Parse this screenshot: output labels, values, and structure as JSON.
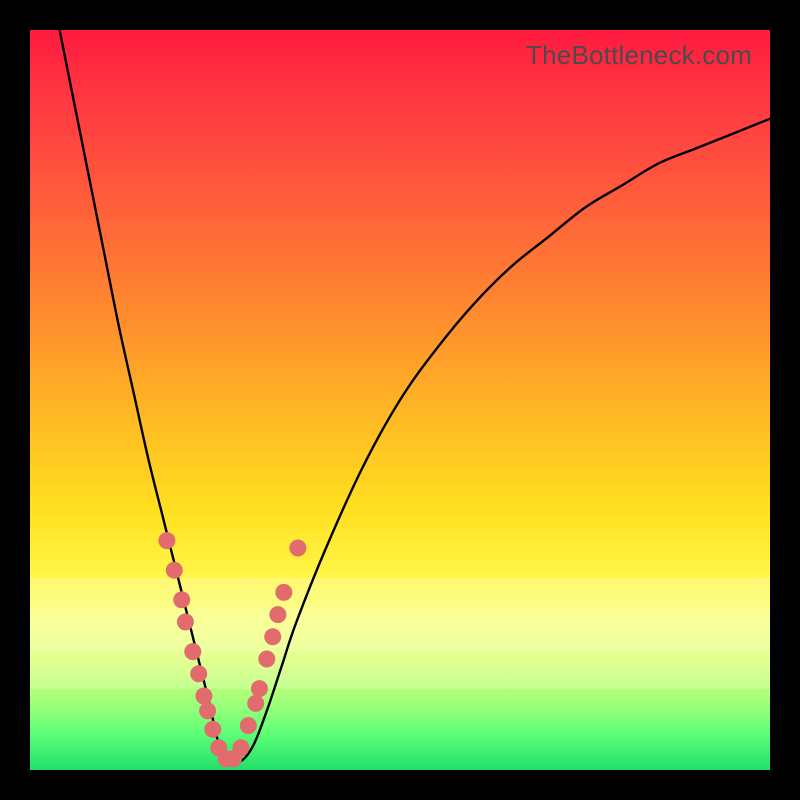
{
  "watermark": "TheBottleneck.com",
  "colors": {
    "curve": "#000000",
    "marker_fill": "#e16b6d",
    "marker_stroke": "#b44a4e",
    "frame": "#000000"
  },
  "chart_data": {
    "type": "line",
    "title": "",
    "xlabel": "",
    "ylabel": "",
    "xlim": [
      0,
      100
    ],
    "ylim": [
      0,
      100
    ],
    "grid": false,
    "legend": false,
    "note": "No axis ticks or numeric labels are rendered in the image; curve shape is a V/valley with minimum near x≈26 and y≈0. Values below are estimated from pixel positions (y = 0 at bottom, 100 at top).",
    "series": [
      {
        "name": "bottleneck-curve",
        "x": [
          4,
          6,
          8,
          10,
          12,
          14,
          16,
          18,
          20,
          22,
          24,
          26,
          28,
          30,
          32,
          34,
          36,
          40,
          45,
          50,
          55,
          60,
          65,
          70,
          75,
          80,
          85,
          90,
          95,
          100
        ],
        "y": [
          100,
          90,
          80,
          70,
          60,
          51,
          42,
          34,
          26,
          18,
          10,
          2,
          1,
          3,
          8,
          14,
          20,
          30,
          41,
          50,
          57,
          63,
          68,
          72,
          76,
          79,
          82,
          84,
          86,
          88
        ]
      }
    ],
    "markers": {
      "name": "highlight-points",
      "note": "Salmon-colored dots clustered near the valley on both branches.",
      "points": [
        {
          "x": 18.5,
          "y": 31
        },
        {
          "x": 19.5,
          "y": 27
        },
        {
          "x": 20.5,
          "y": 23
        },
        {
          "x": 21.0,
          "y": 20
        },
        {
          "x": 22.0,
          "y": 16
        },
        {
          "x": 22.8,
          "y": 13
        },
        {
          "x": 23.5,
          "y": 10
        },
        {
          "x": 24.0,
          "y": 8
        },
        {
          "x": 24.7,
          "y": 5.5
        },
        {
          "x": 25.5,
          "y": 3
        },
        {
          "x": 26.5,
          "y": 1.5
        },
        {
          "x": 27.5,
          "y": 1.5
        },
        {
          "x": 28.5,
          "y": 3
        },
        {
          "x": 29.5,
          "y": 6
        },
        {
          "x": 30.5,
          "y": 9
        },
        {
          "x": 31.0,
          "y": 11
        },
        {
          "x": 32.0,
          "y": 15
        },
        {
          "x": 32.8,
          "y": 18
        },
        {
          "x": 33.5,
          "y": 21
        },
        {
          "x": 34.3,
          "y": 24
        },
        {
          "x": 36.2,
          "y": 30
        }
      ]
    }
  }
}
